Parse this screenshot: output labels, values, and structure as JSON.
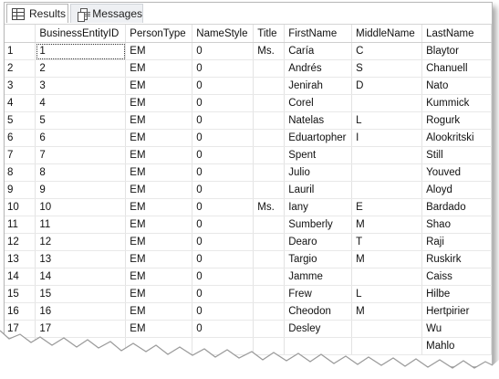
{
  "tabs": {
    "results_label": "Results",
    "messages_label": "Messages"
  },
  "grid": {
    "columns": [
      "",
      "BusinessEntityID",
      "PersonType",
      "NameStyle",
      "Title",
      "FirstName",
      "MiddleName",
      "LastName"
    ],
    "rows": [
      [
        "1",
        "1",
        "EM",
        "0",
        "Ms.",
        "Caría",
        "C",
        "Blaytor"
      ],
      [
        "2",
        "2",
        "EM",
        "0",
        "",
        "Andrés",
        "S",
        "Chanuell"
      ],
      [
        "3",
        "3",
        "EM",
        "0",
        "",
        "Jenirah",
        "D",
        "Nato"
      ],
      [
        "4",
        "4",
        "EM",
        "0",
        "",
        "Corel",
        "",
        "Kummick"
      ],
      [
        "5",
        "5",
        "EM",
        "0",
        "",
        "Natelas",
        "L",
        "Rogurk"
      ],
      [
        "6",
        "6",
        "EM",
        "0",
        "",
        "Eduartopher",
        "I",
        "Alookritski"
      ],
      [
        "7",
        "7",
        "EM",
        "0",
        "",
        "Spent",
        "",
        "Still"
      ],
      [
        "8",
        "8",
        "EM",
        "0",
        "",
        "Julio",
        "",
        "Youved"
      ],
      [
        "9",
        "9",
        "EM",
        "0",
        "",
        "Lauril",
        "",
        "Aloyd"
      ],
      [
        "10",
        "10",
        "EM",
        "0",
        "Ms.",
        "Iany",
        "E",
        "Bardado"
      ],
      [
        "11",
        "11",
        "EM",
        "0",
        "",
        "Sumberly",
        "M",
        "Shao"
      ],
      [
        "12",
        "12",
        "EM",
        "0",
        "",
        "Dearo",
        "T",
        "Raji"
      ],
      [
        "13",
        "13",
        "EM",
        "0",
        "",
        "Targio",
        "M",
        "Ruskirk"
      ],
      [
        "14",
        "14",
        "EM",
        "0",
        "",
        "Jamme",
        "",
        "Caiss"
      ],
      [
        "15",
        "15",
        "EM",
        "0",
        "",
        "Frew",
        "L",
        "Hilbe"
      ],
      [
        "16",
        "16",
        "EM",
        "0",
        "",
        "Cheodon",
        "M",
        "Hertpirier"
      ],
      [
        "17",
        "17",
        "EM",
        "0",
        "",
        "Desley",
        "",
        "Wu"
      ],
      [
        "",
        "",
        "",
        "",
        "",
        "",
        "",
        "Mahlo"
      ]
    ]
  }
}
